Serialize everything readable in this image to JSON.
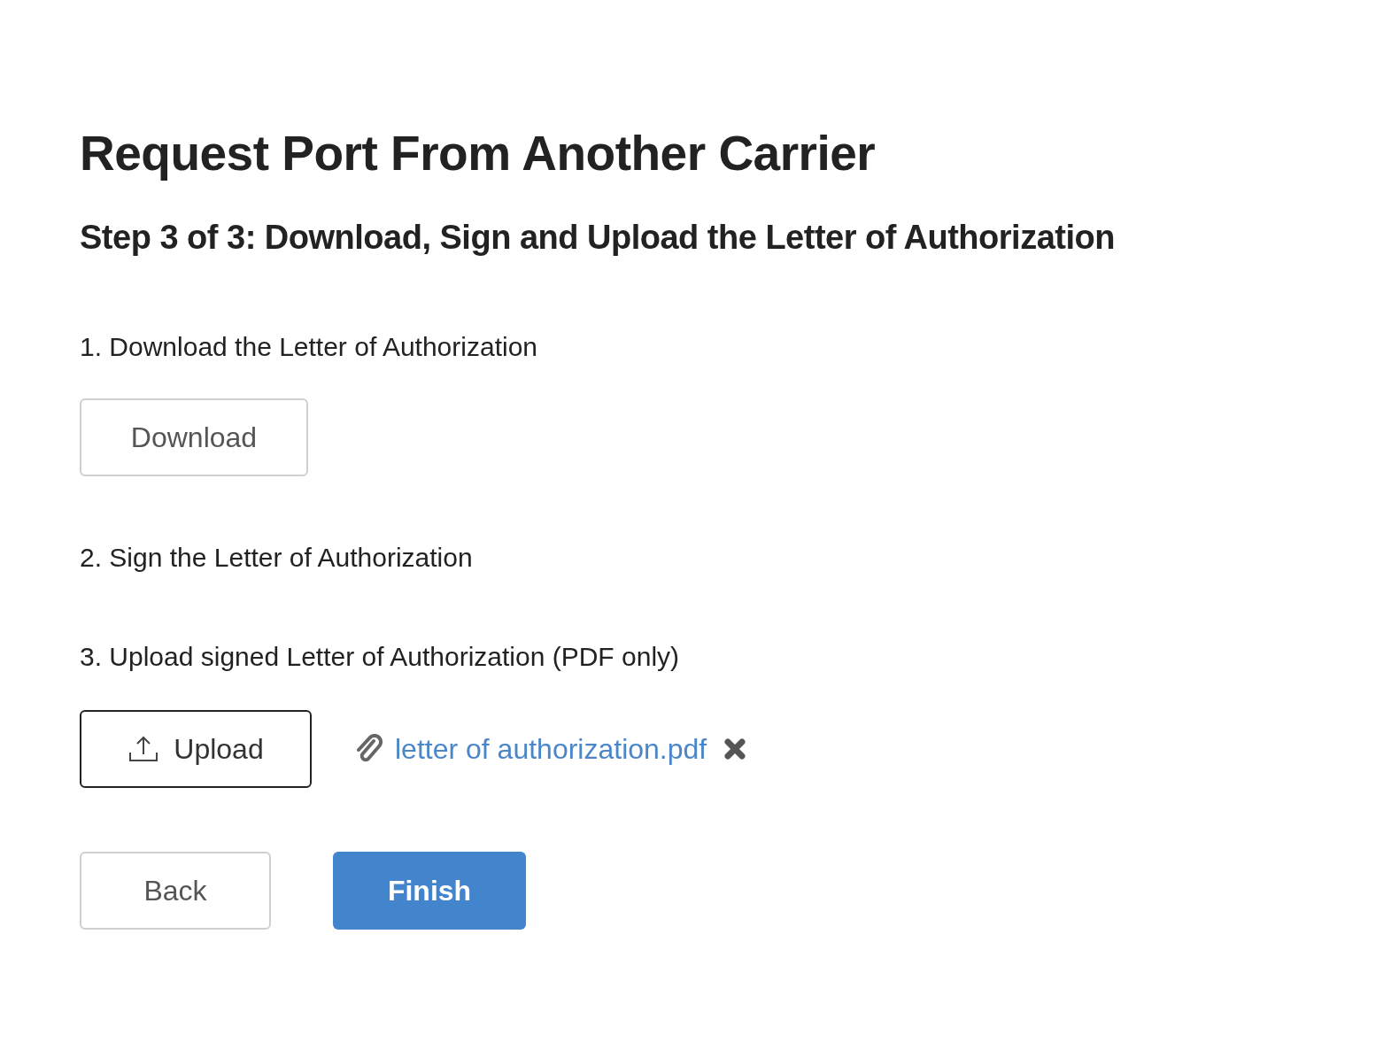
{
  "title": "Request Port From Another Carrier",
  "subtitle": "Step 3 of 3: Download, Sign and Upload the Letter of Authorization",
  "steps": [
    {
      "kind": "download",
      "label": "1. Download the Letter of Authorization",
      "button": "Download"
    },
    {
      "kind": "text",
      "label": "2. Sign the Letter of Authorization"
    },
    {
      "kind": "upload",
      "label": "3. Upload signed Letter of Authorization (PDF only)",
      "button": "Upload",
      "file": "letter of authorization.pdf"
    }
  ],
  "actions": [
    {
      "kind": "secondary",
      "label": "Back"
    },
    {
      "kind": "primary",
      "label": "Finish"
    }
  ]
}
